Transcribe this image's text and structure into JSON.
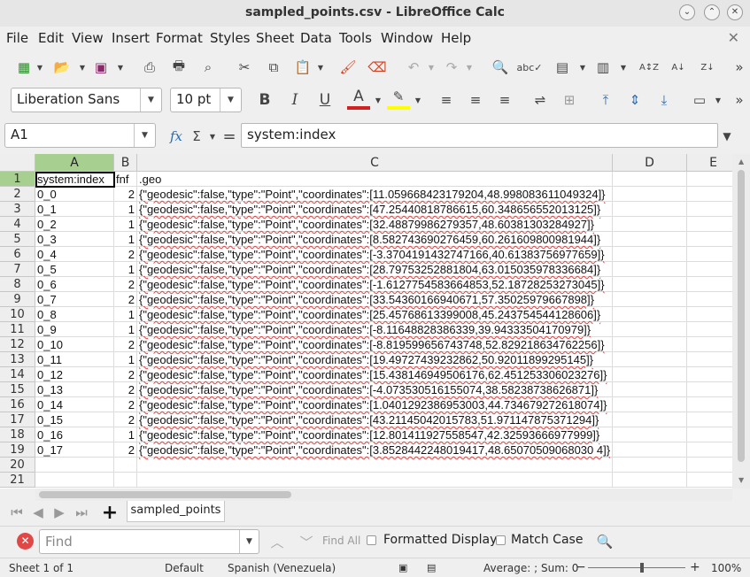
{
  "window": {
    "title": "sampled_points.csv - LibreOffice Calc"
  },
  "menu": [
    "File",
    "Edit",
    "View",
    "Insert",
    "Format",
    "Styles",
    "Sheet",
    "Data",
    "Tools",
    "Window",
    "Help"
  ],
  "format_bar": {
    "font_name": "Liberation Sans",
    "font_size": "10 pt"
  },
  "formula_bar": {
    "cell_ref": "A1",
    "content": "system:index"
  },
  "grid": {
    "columns": [
      "A",
      "B",
      "C",
      "D",
      "E"
    ],
    "rows": [
      [
        "system:index",
        "fnf",
        ".geo"
      ],
      [
        "0_0",
        "2",
        "{\"geodesic\":false,\"type\":\"Point\",\"coordinates\":[11.059668423179204,48.998083611049324]}"
      ],
      [
        "0_1",
        "1",
        "{\"geodesic\":false,\"type\":\"Point\",\"coordinates\":[47.25440818786615,60.348656552013125]}"
      ],
      [
        "0_2",
        "1",
        "{\"geodesic\":false,\"type\":\"Point\",\"coordinates\":[32.48879986279357,48.60381303284927]}"
      ],
      [
        "0_3",
        "1",
        "{\"geodesic\":false,\"type\":\"Point\",\"coordinates\":[8.582743690276459,60.261609800981944]}"
      ],
      [
        "0_4",
        "2",
        "{\"geodesic\":false,\"type\":\"Point\",\"coordinates\":[-3.3704191432747166,40.61383756977659]}"
      ],
      [
        "0_5",
        "1",
        "{\"geodesic\":false,\"type\":\"Point\",\"coordinates\":[28.79753252881804,63.015035978336684]}"
      ],
      [
        "0_6",
        "2",
        "{\"geodesic\":false,\"type\":\"Point\",\"coordinates\":[-1.6127754583664853,52.18728253273045]}"
      ],
      [
        "0_7",
        "2",
        "{\"geodesic\":false,\"type\":\"Point\",\"coordinates\":[33.54360166940671,57.35025979667898]}"
      ],
      [
        "0_8",
        "1",
        "{\"geodesic\":false,\"type\":\"Point\",\"coordinates\":[25.45768613399008,45.243754544128606]}"
      ],
      [
        "0_9",
        "1",
        "{\"geodesic\":false,\"type\":\"Point\",\"coordinates\":[-8.11648828386339,39.94333504170979]}"
      ],
      [
        "0_10",
        "2",
        "{\"geodesic\":false,\"type\":\"Point\",\"coordinates\":[-8.819599656743748,52.829218634762256]}"
      ],
      [
        "0_11",
        "1",
        "{\"geodesic\":false,\"type\":\"Point\",\"coordinates\":[19.49727439232862,50.92011899295145]}"
      ],
      [
        "0_12",
        "2",
        "{\"geodesic\":false,\"type\":\"Point\",\"coordinates\":[15.438146949506176,62.451253306023276]}"
      ],
      [
        "0_13",
        "2",
        "{\"geodesic\":false,\"type\":\"Point\",\"coordinates\":[-4.073530516155074,38.58238738626871]}"
      ],
      [
        "0_14",
        "2",
        "{\"geodesic\":false,\"type\":\"Point\",\"coordinates\":[1.0401292386953003,44.734679272618074]}"
      ],
      [
        "0_15",
        "2",
        "{\"geodesic\":false,\"type\":\"Point\",\"coordinates\":[43.21145042015783,51.971147875371294]}"
      ],
      [
        "0_16",
        "1",
        "{\"geodesic\":false,\"type\":\"Point\",\"coordinates\":[12.801411927558547,42.32593666977999]}"
      ],
      [
        "0_17",
        "2",
        "{\"geodesic\":false,\"type\":\"Point\",\"coordinates\":[3.8528442248019417,48.65070509068030 4]}"
      ],
      [
        "",
        "",
        ""
      ],
      [
        "",
        "",
        ""
      ]
    ]
  },
  "sheet_tab": "sampled_points",
  "find_bar": {
    "placeholder": "Find",
    "find_all": "Find All",
    "formatted_display": "Formatted Display",
    "match_case": "Match Case"
  },
  "status": {
    "sheet": "Sheet 1 of 1",
    "style": "Default",
    "language": "Spanish (Venezuela)",
    "summary": "Average: ; Sum: 0",
    "zoom": "100%"
  },
  "colors": {
    "selection_header": "#a6cf90",
    "font_color": "#d02020",
    "highlight": "#ffff00"
  }
}
